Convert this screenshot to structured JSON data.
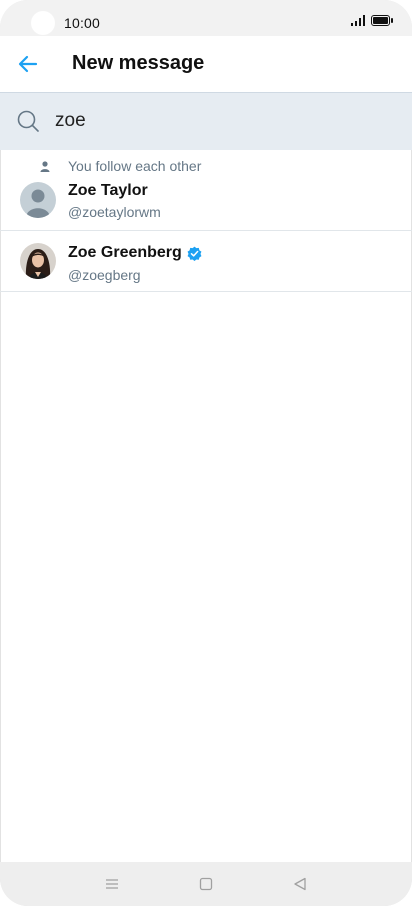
{
  "status_bar": {
    "time": "10:00"
  },
  "header": {
    "title": "New message",
    "back_icon": "arrow-left-icon",
    "accent": "#1da1f2"
  },
  "search": {
    "query": "zoe",
    "icon": "search-icon"
  },
  "results": [
    {
      "context": "You follow each other",
      "name": "Zoe Taylor",
      "handle": "@zoetaylorwm",
      "verified": false,
      "avatar": "default-avatar"
    },
    {
      "context": "",
      "name": "Zoe Greenberg",
      "handle": "@zoegberg",
      "verified": true,
      "avatar": "photo-avatar"
    }
  ],
  "colors": {
    "search_background": "#e6ecf2",
    "secondary_text": "#657786",
    "verified_blue": "#1da1f2"
  },
  "nav": {
    "icons": [
      "menu-icon",
      "home-square-icon",
      "back-triangle-icon"
    ]
  }
}
